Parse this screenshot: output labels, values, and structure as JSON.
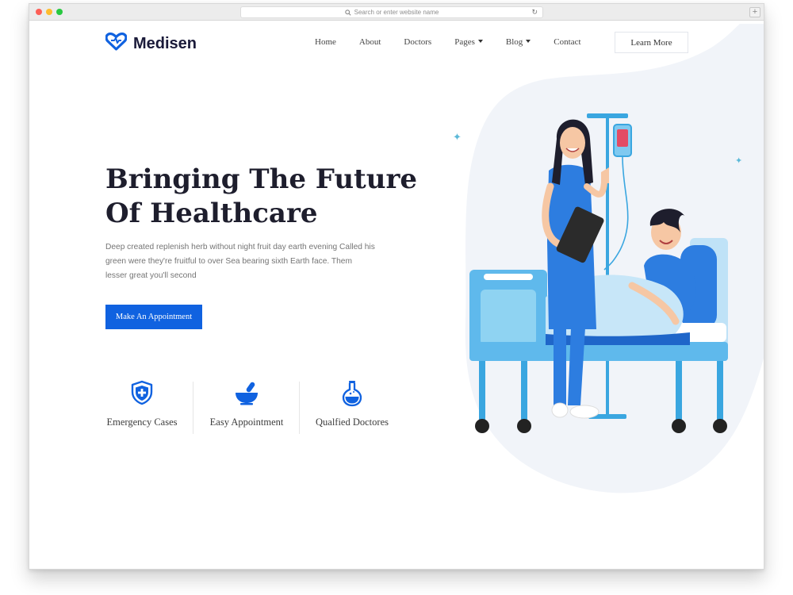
{
  "browser": {
    "url_placeholder": "Search or enter website name"
  },
  "brand": {
    "name": "Medisen",
    "accent": "#1062e0",
    "logo_icon": "heart-icon"
  },
  "nav": {
    "items": [
      {
        "label": "Home",
        "dropdown": false
      },
      {
        "label": "About",
        "dropdown": false
      },
      {
        "label": "Doctors",
        "dropdown": false
      },
      {
        "label": "Pages",
        "dropdown": true
      },
      {
        "label": "Blog",
        "dropdown": true
      },
      {
        "label": "Contact",
        "dropdown": false
      }
    ],
    "cta_label": "Learn More"
  },
  "hero": {
    "title_line1": "Bringing The Future",
    "title_line2": "Of Healthcare",
    "description": "Deep created replenish herb without night fruit day earth evening Called his green were they're fruitful to over Sea bearing sixth Earth face. Them lesser great you'll second",
    "button_label": "Make An Appointment"
  },
  "features": [
    {
      "label": "Emergency Cases",
      "icon": "shield-plus-icon"
    },
    {
      "label": "Easy Appointment",
      "icon": "mortar-pestle-icon"
    },
    {
      "label": "Qualfied Doctores",
      "icon": "flask-icon"
    }
  ],
  "colors": {
    "blob": "#f1f4f9",
    "primary_blue": "#1062e0",
    "illustration_blue": "#2d7de0",
    "light_blue": "#8fd3f2"
  }
}
